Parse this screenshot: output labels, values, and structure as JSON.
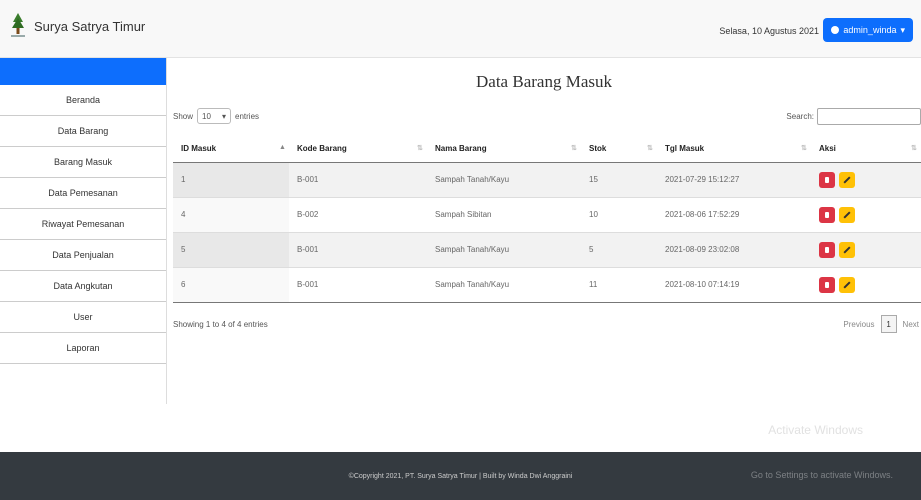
{
  "header": {
    "brand": "Surya Satrya Timur",
    "date": "Selasa, 10 Agustus 2021",
    "user": "admin_winda"
  },
  "sidebar": {
    "items": [
      {
        "label": "Beranda"
      },
      {
        "label": "Data Barang"
      },
      {
        "label": "Barang Masuk"
      },
      {
        "label": "Data Pemesanan"
      },
      {
        "label": "Riwayat Pemesanan"
      },
      {
        "label": "Data Penjualan"
      },
      {
        "label": "Data Angkutan"
      },
      {
        "label": "User"
      },
      {
        "label": "Laporan"
      }
    ]
  },
  "main": {
    "title": "Data Barang Masuk",
    "show_label": "Show",
    "show_value": "10",
    "entries_label": "entries",
    "search_label": "Search:",
    "columns": [
      "ID Masuk",
      "Kode Barang",
      "Nama Barang",
      "Stok",
      "Tgl Masuk",
      "Aksi"
    ],
    "rows": [
      {
        "id": "1",
        "kode": "B-001",
        "nama": "Sampah Tanah/Kayu",
        "stok": "15",
        "tgl": "2021-07-29 15:12:27"
      },
      {
        "id": "4",
        "kode": "B-002",
        "nama": "Sampah Sibitan",
        "stok": "10",
        "tgl": "2021-08-06 17:52:29"
      },
      {
        "id": "5",
        "kode": "B-001",
        "nama": "Sampah Tanah/Kayu",
        "stok": "5",
        "tgl": "2021-08-09 23:02:08"
      },
      {
        "id": "6",
        "kode": "B-001",
        "nama": "Sampah Tanah/Kayu",
        "stok": "11",
        "tgl": "2021-08-10 07:14:19"
      }
    ],
    "info": "Showing 1 to 4 of 4 entries",
    "pagination": {
      "previous": "Previous",
      "current": "1",
      "next": "Next"
    }
  },
  "footer": {
    "text": "©Copyright 2021, PT. Surya Satrya Timur | Built by Winda Dwi Anggraini"
  },
  "watermark": {
    "line1": "Activate Windows",
    "line2": "Go to Settings to activate Windows."
  },
  "colors": {
    "primary": "#0d6efd",
    "danger": "#dc3545",
    "warning": "#ffc107",
    "footer": "#343a40"
  }
}
